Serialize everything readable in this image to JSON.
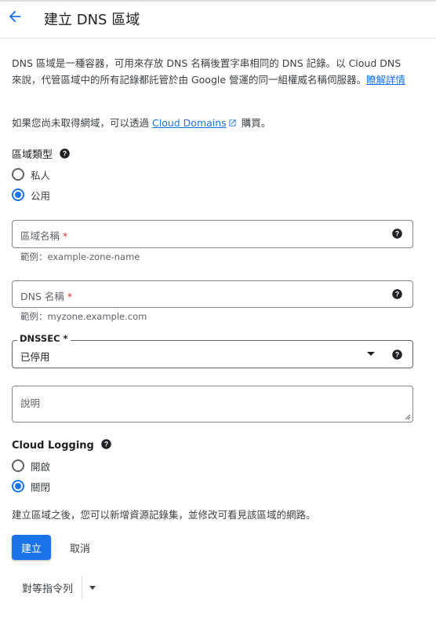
{
  "header": {
    "title": "建立 DNS 區域"
  },
  "intro": {
    "text": "DNS 區域是一種容器，可用來存放 DNS 名稱後置字串相同的 DNS 記錄。以 Cloud DNS 來說，代管區域中的所有記錄都託管於由 Google 營運的同一組權威名稱伺服器。",
    "learn_more": "瞭解詳情",
    "domains_prefix": "如果您尚未取得網域，可以透過",
    "domains_link": "Cloud Domains",
    "domains_suffix": "購買。"
  },
  "zone_type": {
    "label": "區域類型",
    "options": [
      {
        "label": "私人",
        "selected": false
      },
      {
        "label": "公用",
        "selected": true
      }
    ]
  },
  "zone_name": {
    "placeholder": "區域名稱",
    "required_mark": "*",
    "hint": "範例：example-zone-name"
  },
  "dns_name": {
    "placeholder": "DNS 名稱",
    "required_mark": "*",
    "hint": "範例：myzone.example.com"
  },
  "dnssec": {
    "label": "DNSSEC",
    "required_mark": "*",
    "value": "已停用"
  },
  "description": {
    "placeholder": "說明"
  },
  "logging": {
    "label": "Cloud Logging",
    "options": [
      {
        "label": "開啟",
        "selected": false
      },
      {
        "label": "關閉",
        "selected": true
      }
    ]
  },
  "footer_note": "建立區域之後，您可以新增資源記錄集，並修改可看見該區域的網路。",
  "actions": {
    "create": "建立",
    "cancel": "取消",
    "equivalent": "對等指令列"
  },
  "colors": {
    "accent": "#1a73e8",
    "required": "#d93025"
  }
}
